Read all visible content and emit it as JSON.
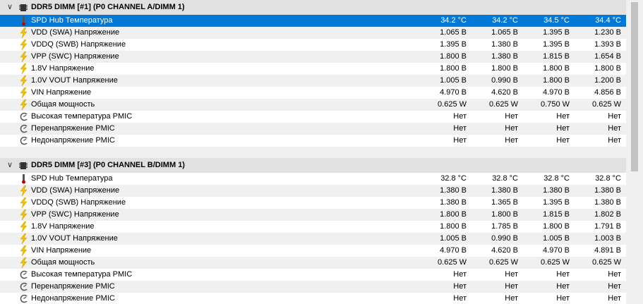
{
  "groups": [
    {
      "title": "DDR5 DIMM [#1] (P0 CHANNEL A/DIMM 1)",
      "rows": [
        {
          "icon": "thermometer-icon",
          "label": "SPD Hub Температура",
          "values": [
            "34.2 °C",
            "34.2 °C",
            "34.5 °C",
            "34.4 °C"
          ],
          "selected": true
        },
        {
          "icon": "lightning-icon",
          "label": "VDD (SWA) Напряжение",
          "values": [
            "1.065 В",
            "1.065 В",
            "1.395 В",
            "1.230 В"
          ]
        },
        {
          "icon": "lightning-icon",
          "label": "VDDQ (SWB) Напряжение",
          "values": [
            "1.395 В",
            "1.380 В",
            "1.395 В",
            "1.393 В"
          ]
        },
        {
          "icon": "lightning-icon",
          "label": "VPP (SWC) Напряжение",
          "values": [
            "1.800 В",
            "1.380 В",
            "1.815 В",
            "1.654 В"
          ]
        },
        {
          "icon": "lightning-icon",
          "label": "1.8V Напряжение",
          "values": [
            "1.800 В",
            "1.800 В",
            "1.800 В",
            "1.800 В"
          ]
        },
        {
          "icon": "lightning-icon",
          "label": "1.0V VOUT Напряжение",
          "values": [
            "1.005 В",
            "0.990 В",
            "1.800 В",
            "1.200 В"
          ]
        },
        {
          "icon": "lightning-icon",
          "label": "VIN Напряжение",
          "values": [
            "4.970 В",
            "4.620 В",
            "4.970 В",
            "4.856 В"
          ]
        },
        {
          "icon": "lightning-icon",
          "label": "Общая мощность",
          "values": [
            "0.625 W",
            "0.625 W",
            "0.750 W",
            "0.625 W"
          ]
        },
        {
          "icon": "gauge-icon",
          "label": "Высокая температура PMIC",
          "values": [
            "Нет",
            "Нет",
            "Нет",
            "Нет"
          ]
        },
        {
          "icon": "gauge-icon",
          "label": "Перенапряжение PMIC",
          "values": [
            "Нет",
            "Нет",
            "Нет",
            "Нет"
          ]
        },
        {
          "icon": "gauge-icon",
          "label": "Недонапряжение PMIC",
          "values": [
            "Нет",
            "Нет",
            "Нет",
            "Нет"
          ]
        }
      ]
    },
    {
      "title": "DDR5 DIMM [#3] (P0 CHANNEL B/DIMM 1)",
      "rows": [
        {
          "icon": "thermometer-icon",
          "label": "SPD Hub Температура",
          "values": [
            "32.8 °C",
            "32.8 °C",
            "32.8 °C",
            "32.8 °C"
          ]
        },
        {
          "icon": "lightning-icon",
          "label": "VDD (SWA) Напряжение",
          "values": [
            "1.380 В",
            "1.380 В",
            "1.380 В",
            "1.380 В"
          ]
        },
        {
          "icon": "lightning-icon",
          "label": "VDDQ (SWB) Напряжение",
          "values": [
            "1.380 В",
            "1.365 В",
            "1.395 В",
            "1.380 В"
          ]
        },
        {
          "icon": "lightning-icon",
          "label": "VPP (SWC) Напряжение",
          "values": [
            "1.800 В",
            "1.800 В",
            "1.815 В",
            "1.802 В"
          ]
        },
        {
          "icon": "lightning-icon",
          "label": "1.8V Напряжение",
          "values": [
            "1.800 В",
            "1.785 В",
            "1.800 В",
            "1.791 В"
          ]
        },
        {
          "icon": "lightning-icon",
          "label": "1.0V VOUT Напряжение",
          "values": [
            "1.005 В",
            "0.990 В",
            "1.005 В",
            "1.003 В"
          ]
        },
        {
          "icon": "lightning-icon",
          "label": "VIN Напряжение",
          "values": [
            "4.970 В",
            "4.620 В",
            "4.970 В",
            "4.891 В"
          ]
        },
        {
          "icon": "lightning-icon",
          "label": "Общая мощность",
          "values": [
            "0.625 W",
            "0.625 W",
            "0.625 W",
            "0.625 W"
          ]
        },
        {
          "icon": "gauge-icon",
          "label": "Высокая температура PMIC",
          "values": [
            "Нет",
            "Нет",
            "Нет",
            "Нет"
          ]
        },
        {
          "icon": "gauge-icon",
          "label": "Перенапряжение PMIC",
          "values": [
            "Нет",
            "Нет",
            "Нет",
            "Нет"
          ]
        },
        {
          "icon": "gauge-icon",
          "label": "Недонапряжение PMIC",
          "values": [
            "Нет",
            "Нет",
            "Нет",
            "Нет"
          ]
        }
      ]
    }
  ],
  "colors": {
    "selection": "#0078d7",
    "lightning": "#f2c200",
    "thermometer": "#c00000"
  }
}
